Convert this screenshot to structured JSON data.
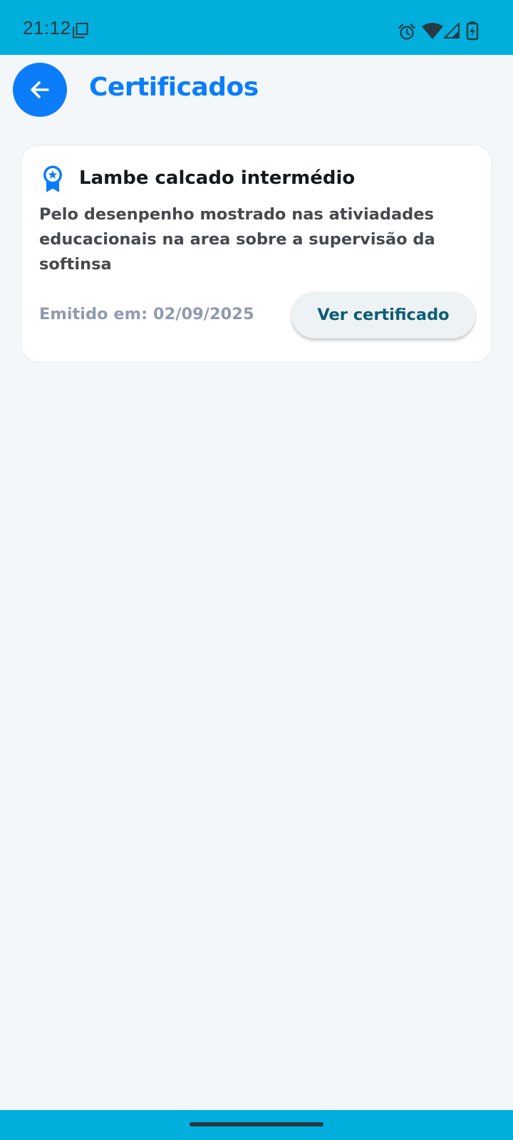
{
  "status_bar": {
    "time": "21:12",
    "icons": [
      "screenshot-icon",
      "alarm-icon",
      "wifi-icon",
      "signal-icon",
      "battery-charging-icon"
    ],
    "background": "#00afdc"
  },
  "header": {
    "back_icon": "arrow-left-icon",
    "title": "Certificados",
    "accent": "#0b7dfb"
  },
  "certificates": [
    {
      "icon": "award-ribbon-icon",
      "title": "Lambe calcado intermédio",
      "description": "Pelo desenpenho mostrado nas ativiadades educacionais na area sobre a supervisão da softinsa",
      "issued": "Emitido em: 02/09/2025",
      "button_label": "Ver certificado"
    }
  ],
  "nav_bar": {
    "background": "#00afdc"
  }
}
